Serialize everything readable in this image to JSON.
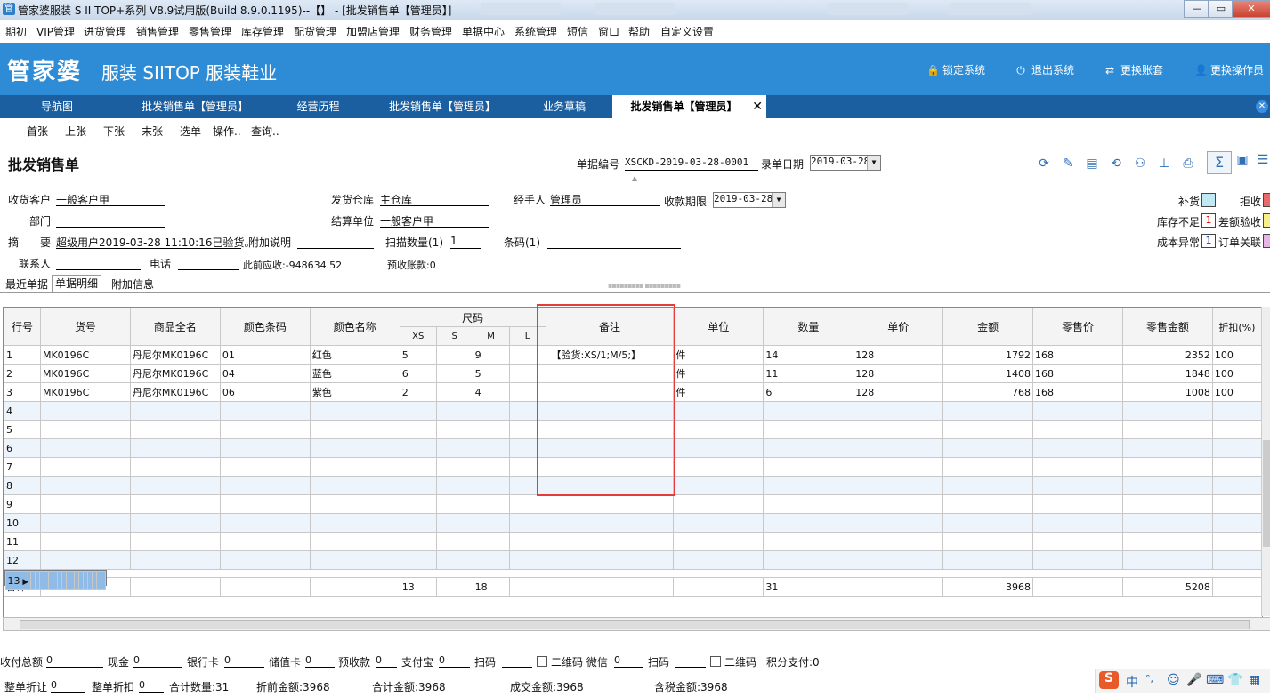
{
  "window": {
    "title": "管家婆服装 S II TOP+系列 V8.9试用版(Build 8.9.0.1195)--【】 - [批发销售单【管理员】]",
    "min": "—",
    "max": "▭",
    "close": "✕"
  },
  "menu": [
    "期初",
    "VIP管理",
    "进货管理",
    "销售管理",
    "零售管理",
    "库存管理",
    "配货管理",
    "加盟店管理",
    "财务管理",
    "单据中心",
    "系统管理",
    "短信",
    "窗口",
    "帮助",
    "自定义设置"
  ],
  "banner": {
    "logo": "管家婆",
    "product": "服装 SIITOP  服装鞋业",
    "actions": [
      {
        "icon": "lock-icon",
        "glyph": "🔒",
        "label": "锁定系统"
      },
      {
        "icon": "power-icon",
        "glyph": "⏻",
        "label": "退出系统"
      },
      {
        "icon": "switch-icon",
        "glyph": "⇄",
        "label": "更换账套"
      },
      {
        "icon": "user-icon",
        "glyph": "👤",
        "label": "更换操作员"
      }
    ]
  },
  "tabs": [
    "导航图",
    "批发销售单【管理员】",
    "经营历程",
    "批发销售单【管理员】",
    "业务草稿",
    "批发销售单【管理员】"
  ],
  "toolbar": [
    "首张",
    "上张",
    "下张",
    "末张",
    "选单",
    "操作..",
    "查询.."
  ],
  "doc": {
    "title": "批发销售单",
    "no_label": "单据编号",
    "no_value": "XSCKD-2019-03-28-0001",
    "date_label": "录单日期",
    "date_value": "2019-03-28"
  },
  "form": {
    "customer_label": "收货客户",
    "customer": "一般客户甲",
    "dept_label": "部门",
    "dept": "",
    "summary_label": "摘　　要",
    "summary": "超级用户2019-03-28 11:10:16已验货。",
    "extra_label": "附加说明",
    "extra": "",
    "warehouse_label": "发货仓库",
    "warehouse": "主仓库",
    "settle_label": "结算单位",
    "settle": "一般客户甲",
    "scan_label": "扫描数量(1)",
    "scan": "1",
    "handler_label": "经手人",
    "handler": "管理员",
    "due_label": "收款期限",
    "due": "2019-03-28",
    "barcode_label": "条码(1)",
    "barcode": "",
    "contact_label": "联系人",
    "contact": "",
    "phone_label": "电话",
    "phone": "",
    "prev_ar": "此前应收:-948634.52",
    "prepaid": "预收账款:0"
  },
  "legend": [
    {
      "label": "补货",
      "color": "#bfe9f5",
      "mark": ""
    },
    {
      "label": "拒收",
      "color": "#e86a6a",
      "mark": ""
    },
    {
      "label": "库存不足",
      "color": "#ffffff",
      "mark": "1"
    },
    {
      "label": "差额验收",
      "color": "#f7f08a",
      "mark": ""
    },
    {
      "label": "成本异常",
      "color": "#ffffff",
      "mark": "1"
    },
    {
      "label": "订单关联",
      "color": "#e8b4e8",
      "mark": ""
    }
  ],
  "subtabs": [
    "最近单据",
    "单据明细",
    "附加信息"
  ],
  "grid": {
    "headers": [
      "行号",
      "货号",
      "商品全名",
      "颜色条码",
      "颜色名称",
      "尺码",
      "备注",
      "单位",
      "数量",
      "单价",
      "金额",
      "零售价",
      "零售金额",
      "折扣(%)"
    ],
    "sizes": [
      "XS",
      "S",
      "M",
      "L"
    ],
    "rows": [
      {
        "n": "1",
        "code": "MK0196C",
        "name": "丹尼尔MK0196C",
        "cb": "01",
        "cn": "红色",
        "xs": "5",
        "s": "",
        "m": "9",
        "l": "",
        "note": "【验货:XS/1;M/5;】",
        "unit": "件",
        "qty": "14",
        "price": "128",
        "amt": "1792",
        "rp": "168",
        "ra": "2352",
        "disc": "100"
      },
      {
        "n": "2",
        "code": "MK0196C",
        "name": "丹尼尔MK0196C",
        "cb": "04",
        "cn": "蓝色",
        "xs": "6",
        "s": "",
        "m": "5",
        "l": "",
        "note": "",
        "unit": "件",
        "qty": "11",
        "price": "128",
        "amt": "1408",
        "rp": "168",
        "ra": "1848",
        "disc": "100"
      },
      {
        "n": "3",
        "code": "MK0196C",
        "name": "丹尼尔MK0196C",
        "cb": "06",
        "cn": "紫色",
        "xs": "2",
        "s": "",
        "m": "4",
        "l": "",
        "note": "",
        "unit": "件",
        "qty": "6",
        "price": "128",
        "amt": "768",
        "rp": "168",
        "ra": "1008",
        "disc": "100"
      },
      {
        "n": "4"
      },
      {
        "n": "5"
      },
      {
        "n": "6"
      },
      {
        "n": "7"
      },
      {
        "n": "8"
      },
      {
        "n": "9"
      },
      {
        "n": "10"
      },
      {
        "n": "11"
      },
      {
        "n": "12"
      },
      {
        "n": "13"
      }
    ],
    "total": {
      "n": "合计",
      "xs": "13",
      "m": "18",
      "qty": "31",
      "amt": "3968",
      "ra": "5208"
    }
  },
  "footer1": [
    {
      "label": "收付总额",
      "value": "0"
    },
    {
      "label": "现金",
      "value": "0"
    },
    {
      "label": "银行卡",
      "value": "0"
    },
    {
      "label": "储值卡",
      "value": "0"
    },
    {
      "label": "预收款",
      "value": "0"
    },
    {
      "label": "支付宝",
      "value": "0"
    },
    {
      "label": "扫码",
      "value": ""
    },
    {
      "label": "二维码 微信",
      "value": "0"
    },
    {
      "label": "扫码",
      "value": ""
    },
    {
      "label": "二维码",
      "value": ""
    },
    {
      "label": "积分支付:0",
      "value": ""
    }
  ],
  "footer2": [
    {
      "label": "整单折让",
      "value": "0"
    },
    {
      "label": "整单折扣",
      "value": "0"
    },
    {
      "label": "合计数量:31"
    },
    {
      "label": "折前金额:3968"
    },
    {
      "label": "合计金额:3968"
    },
    {
      "label": "成交金额:3968"
    },
    {
      "label": "含税金额:3968"
    }
  ],
  "ime": [
    "S",
    "中",
    "°,",
    "☺",
    "🎤",
    "⌨",
    "👕",
    "▦"
  ]
}
